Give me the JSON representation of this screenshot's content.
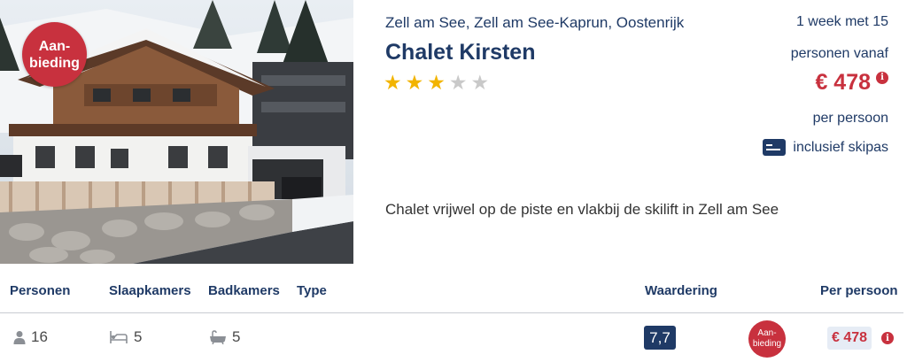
{
  "listing": {
    "badge": "Aan-\nbieding",
    "location": "Zell am See, Zell am See-Kaprun, Oostenrijk",
    "title": "Chalet Kirsten",
    "stars": 3,
    "max_stars": 5,
    "description": "Chalet vrijwel op de piste en vlakbij de skilift in Zell am See"
  },
  "price_block": {
    "line1": "1 week met 15",
    "line2": "personen vanaf",
    "price": "€ 478",
    "per_person": "per persoon",
    "skipas": "inclusief skipas",
    "price_color": "#c8313e",
    "accent_color": "#1f3a66"
  },
  "table": {
    "headers": [
      "Personen",
      "Slaapkamers",
      "Badkamers",
      "Type",
      "Waardering",
      "Per persoon"
    ],
    "row": {
      "personen": "16",
      "slaapkamers": "5",
      "badkamers": "5",
      "type": "",
      "waardering": "7,7",
      "badge": "Aan-\nbieding",
      "price": "€ 478"
    },
    "icons": [
      "person-icon",
      "bed-icon",
      "bathtub-icon",
      "info-icon"
    ]
  }
}
